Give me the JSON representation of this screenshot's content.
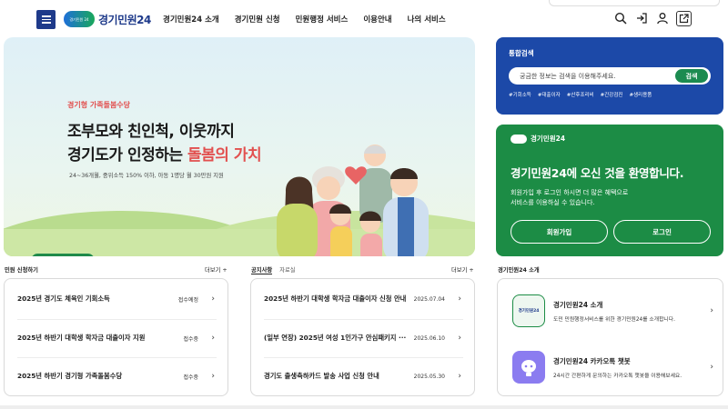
{
  "header": {
    "logo_badge": "경기민원 24",
    "logo_text": "경기민원24",
    "nav": [
      "경기민원24 소개",
      "경기민원 신청",
      "민원행정 서비스",
      "이용안내",
      "나의 서비스"
    ],
    "icons": [
      "search-icon",
      "login-icon",
      "user-icon",
      "external-link-icon"
    ]
  },
  "banner": {
    "subtitle": "경기형 가족돌봄수당",
    "title_line1": "조부모와 친인척, 이웃까지",
    "title_line2_prefix": "경기도가 인정하는 ",
    "title_line2_highlight": "돌봄의 가치",
    "description": "24~36개월, 중위소득 150% 이하, 아동 1명당 월 30만원 지원",
    "pager": {
      "current": "6",
      "separator": "/",
      "total": "24"
    }
  },
  "search": {
    "title": "통합검색",
    "placeholder": "궁금한 정보는 검색을 이용해주세요.",
    "button": "검색",
    "tags": [
      "#기회소득",
      "#대출이자",
      "#산후조리비",
      "#간강검진",
      "#생리용품"
    ]
  },
  "welcome": {
    "logo_text": "경기민원24",
    "title": "경기민원24에 오신 것을 환영합니다.",
    "desc_line1": "회원가입 후 로그인 하시면 더 많은 혜택으로",
    "desc_line2": "서비스를 이용하실 수 있습니다.",
    "signup": "회원가입",
    "login": "로그인"
  },
  "apply": {
    "title": "민원 신청하기",
    "more": "더보기 +",
    "items": [
      {
        "title": "2025년 경기도 체육인 기회소득",
        "status": "접수예정"
      },
      {
        "title": "2025년 하반기 대학생 학자금 대출이자 지원",
        "status": "접수중"
      },
      {
        "title": "2025년 하반기 경기형 가족돌봄수당",
        "status": "접수중"
      }
    ]
  },
  "notice": {
    "tab_active": "공지사항",
    "tab_inactive": "자료실",
    "more": "더보기 +",
    "items": [
      {
        "title": "2025년 하반기 대학생 학자금 대출이자 신청 안내",
        "date": "2025.07.04"
      },
      {
        "title": "(일부 연장) 2025년 여성 1인가구 안심패키지 ···",
        "date": "2025.06.10"
      },
      {
        "title": "경기도 출생축하카드 발송 사업 신청 안내",
        "date": "2025.05.30"
      }
    ]
  },
  "intro": {
    "title": "경기민원24 소개",
    "items": [
      {
        "icon_text": "경기민원24",
        "title": "경기민원24 소개",
        "desc": "도민 민원행정서비스를 위한 경기민원24를 소개합니다."
      },
      {
        "icon_text": "",
        "title": "경기민원24 카카오톡 챗봇",
        "desc": "24시간 간편하게 문의하는 카카오톡 챗봇을 이용해보세요."
      }
    ]
  },
  "colors": {
    "navy": "#1e3a8a",
    "search_blue": "#1c49a8",
    "welcome_green": "#1c8c45",
    "accent_red": "#e2504f"
  }
}
